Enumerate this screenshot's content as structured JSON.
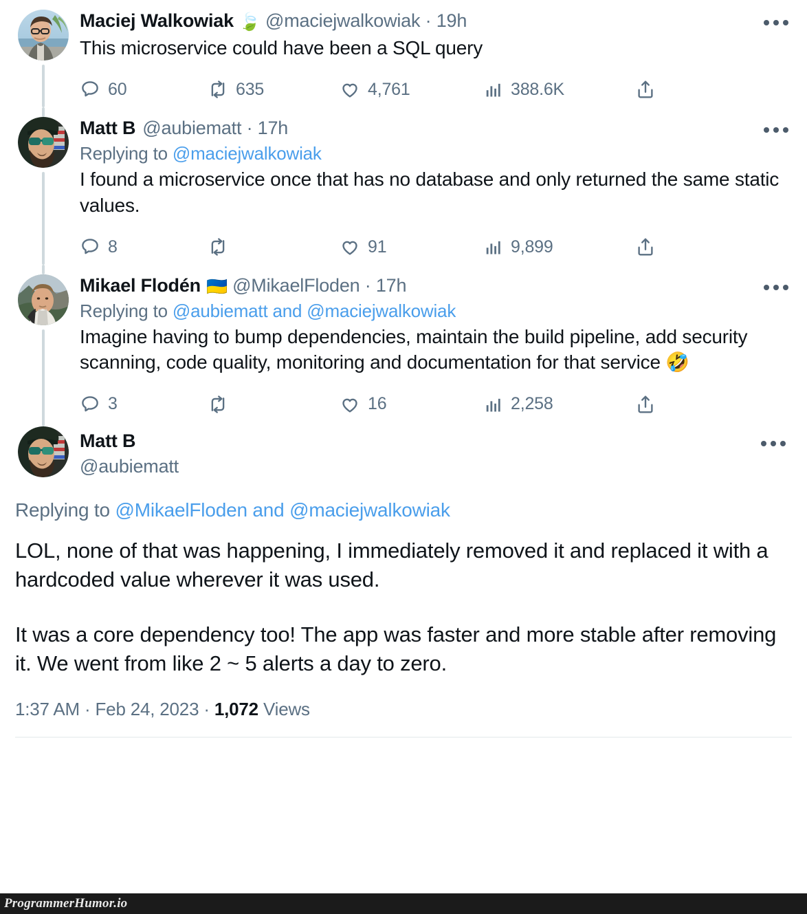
{
  "watermark": {
    "text": "ProgrammerHumor.io"
  },
  "icons": {
    "reply": "reply-icon",
    "retweet": "retweet-icon",
    "like": "heart-icon",
    "views": "analytics-icon",
    "share": "share-icon",
    "more": "more-options-icon"
  },
  "thread": [
    {
      "display_name": "Maciej Walkowiak",
      "name_emoji": "🍃",
      "handle_time": "@maciejwalkowiak · 19h",
      "handle": "@maciejwalkowiak",
      "time": "19h",
      "replying_prefix": "",
      "replying_mentions": "",
      "text": "This microservice could have been a SQL query",
      "metrics": {
        "replies": "60",
        "retweets": "635",
        "likes": "4,761",
        "views": "388.6K"
      }
    },
    {
      "display_name": "Matt B",
      "name_emoji": "",
      "handle_time": "@aubiematt · 17h",
      "handle": "@aubiematt",
      "time": "17h",
      "replying_prefix": "Replying to ",
      "replying_mentions": "@maciejwalkowiak",
      "text": "I found a microservice once that has no database and only returned the same static values.",
      "metrics": {
        "replies": "8",
        "retweets": "",
        "likes": "91",
        "views": "9,899"
      }
    },
    {
      "display_name": "Mikael Flodén",
      "name_emoji": "🇺🇦",
      "handle_time": "@MikaelFloden · 17h",
      "handle": "@MikaelFloden",
      "time": "17h",
      "replying_prefix": "Replying to ",
      "replying_mentions": "@aubiematt and @maciejwalkowiak",
      "text": "Imagine having to bump dependencies, maintain the build pipeline, add security scanning, code quality, monitoring and documentation for that service 🤣",
      "metrics": {
        "replies": "3",
        "retweets": "",
        "likes": "16",
        "views": "2,258"
      }
    }
  ],
  "main_tweet": {
    "display_name": "Matt B",
    "handle": "@aubiematt",
    "replying_prefix": "Replying to ",
    "replying_mentions": "@MikaelFloden and @maciejwalkowiak",
    "paragraph_1": "LOL, none of that was happening, I immediately removed it and replaced it with a hardcoded value wherever it was used.",
    "paragraph_2": "It was a core dependency too! The app was faster and more stable after removing it. We went from like 2 ~ 5 alerts a day to zero.",
    "timestamp": "1:37 AM · Feb 24, 2023 · ",
    "views_count": "1,072",
    "views_label": " Views"
  },
  "colors": {
    "link_blue": "#4a9eeb",
    "text_primary": "#0f1419",
    "text_secondary": "#5b7083",
    "thread_line": "#cfd9dd",
    "watermark_bg": "#1b1b1b"
  }
}
